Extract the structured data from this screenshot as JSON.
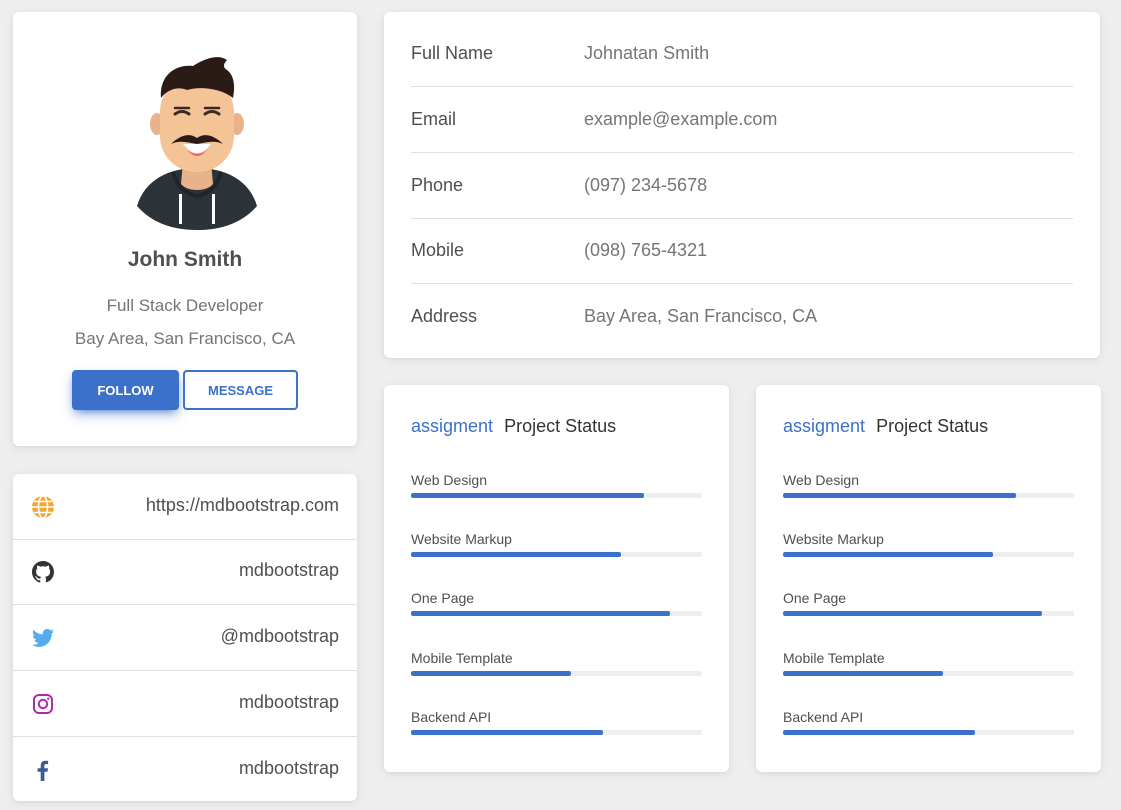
{
  "profile": {
    "name": "John Smith",
    "title": "Full Stack Developer",
    "location": "Bay Area, San Francisco, CA",
    "follow_label": "FOLLOW",
    "message_label": "MESSAGE",
    "avatar_icon": "avatar-illustration"
  },
  "links": [
    {
      "icon": "globe-icon",
      "text": "https://mdbootstrap.com",
      "color": "#f2a734"
    },
    {
      "icon": "github-icon",
      "text": "mdbootstrap",
      "color": "#333333"
    },
    {
      "icon": "twitter-icon",
      "text": "@mdbootstrap",
      "color": "#55acee"
    },
    {
      "icon": "instagram-icon",
      "text": "mdbootstrap",
      "color": "#ac2bac"
    },
    {
      "icon": "facebook-icon",
      "text": "mdbootstrap",
      "color": "#3b5998"
    }
  ],
  "info": [
    {
      "label": "Full Name",
      "value": "Johnatan Smith"
    },
    {
      "label": "Email",
      "value": "example@example.com"
    },
    {
      "label": "Phone",
      "value": "(097) 234-5678"
    },
    {
      "label": "Mobile",
      "value": "(098) 765-4321"
    },
    {
      "label": "Address",
      "value": "Bay Area, San Francisco, CA"
    }
  ],
  "status_cards": [
    {
      "accent": "assigment",
      "title": "Project Status",
      "items": [
        {
          "label": "Web Design",
          "progress": 80
        },
        {
          "label": "Website Markup",
          "progress": 72
        },
        {
          "label": "One Page",
          "progress": 89
        },
        {
          "label": "Mobile Template",
          "progress": 55
        },
        {
          "label": "Backend API",
          "progress": 66
        }
      ]
    },
    {
      "accent": "assigment",
      "title": "Project Status",
      "items": [
        {
          "label": "Web Design",
          "progress": 80
        },
        {
          "label": "Website Markup",
          "progress": 72
        },
        {
          "label": "One Page",
          "progress": 89
        },
        {
          "label": "Mobile Template",
          "progress": 55
        },
        {
          "label": "Backend API",
          "progress": 66
        }
      ]
    }
  ],
  "colors": {
    "primary": "#3b71ca",
    "background": "#eeeeee",
    "text": "#4f4f4f",
    "muted": "#757575"
  }
}
